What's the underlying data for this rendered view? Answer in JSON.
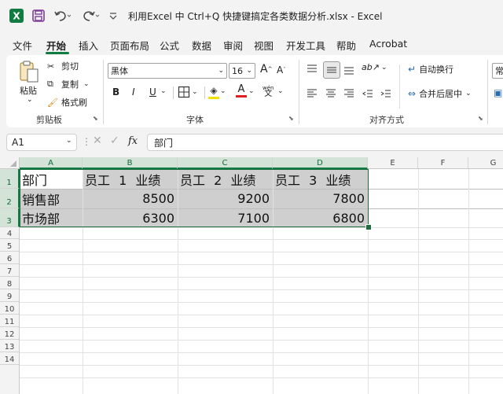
{
  "titlebar": {
    "title": "利用Excel 中 Ctrl+Q 快捷键搞定各类数据分析.xlsx  -  Excel",
    "app_icon": "excel-icon",
    "save_icon": "save-icon",
    "undo_icon": "undo-icon",
    "redo_icon": "redo-icon",
    "customize_icon": "customize-qat-icon"
  },
  "menu": {
    "items": [
      "文件",
      "开始",
      "插入",
      "页面布局",
      "公式",
      "数据",
      "审阅",
      "视图",
      "开发工具",
      "帮助",
      "Acrobat"
    ],
    "active": "开始"
  },
  "ribbon": {
    "clipboard": {
      "paste": "粘贴",
      "cut": "剪切",
      "copy": "复制",
      "format_painter": "格式刷",
      "group_label": "剪贴板"
    },
    "font": {
      "font_name": "黑体",
      "font_size": "16",
      "increase_size": "A",
      "decrease_size": "A",
      "bold": "B",
      "italic": "I",
      "underline": "U",
      "font_color_letter": "A",
      "phonetic": "wén",
      "group_label": "字体",
      "fill_color": "#f2e100",
      "font_color": "#e02020"
    },
    "alignment": {
      "wrap_text": "自动换行",
      "merge_center": "合并后居中",
      "group_label": "对齐方式"
    },
    "next_group_partial": "常"
  },
  "formula_bar": {
    "name_box": "A1",
    "fx": "fx",
    "content": "部门"
  },
  "sheet": {
    "columns": [
      "A",
      "B",
      "C",
      "D",
      "E",
      "F",
      "G"
    ],
    "rows": [
      "1",
      "2",
      "3",
      "4",
      "5",
      "6",
      "7",
      "8",
      "9",
      "10",
      "11",
      "12",
      "13",
      "14"
    ],
    "data": [
      [
        "部门",
        "员工 1 业绩",
        "员工 2 业绩",
        "员工 3 业绩"
      ],
      [
        "销售部",
        "8500",
        "9200",
        "7800"
      ],
      [
        "市场部",
        "6300",
        "7100",
        "6800"
      ]
    ],
    "accent": "#107c41",
    "selection_color": "#1e6e42",
    "selection_fill": "#cfcfcf"
  }
}
